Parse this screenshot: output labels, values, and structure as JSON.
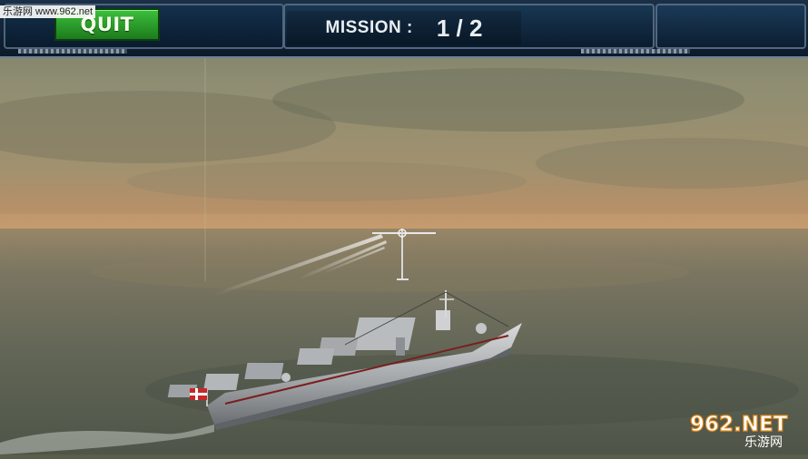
{
  "hud": {
    "quit_label": "QUIT",
    "mission_label": "MISSION :",
    "mission_value": "1 / 2"
  },
  "watermark": {
    "top_text": "乐游网 www.962.net",
    "bottom_main": "962.NET",
    "bottom_sub": "乐游网"
  },
  "colors": {
    "hud_bg": "#0c1a2b",
    "quit_green": "#2aa12a",
    "sea": "#596052",
    "sky_horizon": "#b28b5f"
  },
  "icons": {
    "crosshair": "crosshair-icon",
    "flag": "flag-icon"
  }
}
